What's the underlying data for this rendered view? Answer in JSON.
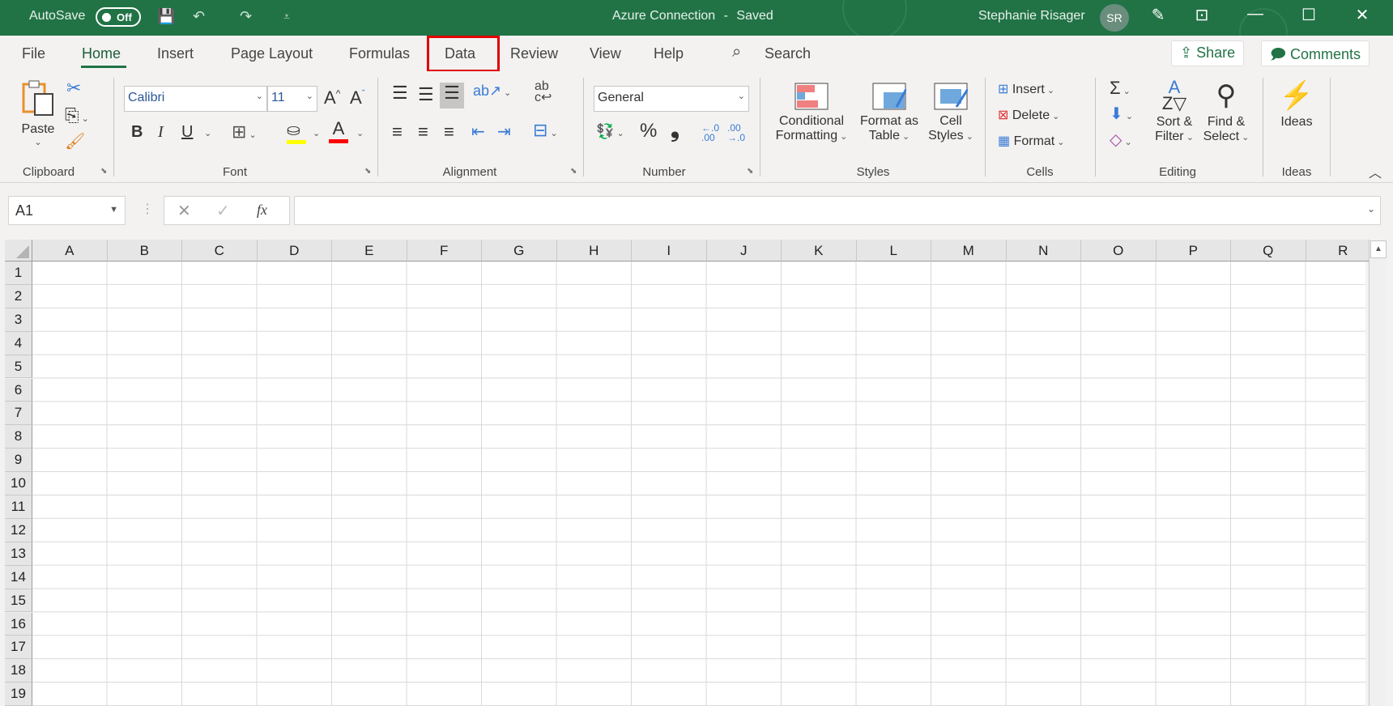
{
  "titlebar": {
    "autosave_label": "AutoSave",
    "autosave_state": "Off",
    "document_title": "Azure Connection",
    "title_separator": "-",
    "save_status": "Saved",
    "user_name": "Stephanie Risager",
    "user_initials": "SR",
    "icons": {
      "save": "💾",
      "undo": "↶",
      "redo": "↷",
      "customize": "⩡",
      "coauth": "✎",
      "ribbon_display": "⊡",
      "minimize": "—",
      "maximize": "☐",
      "close": "✕"
    }
  },
  "tabs": {
    "items": [
      {
        "label": "File"
      },
      {
        "label": "Home",
        "active": true
      },
      {
        "label": "Insert"
      },
      {
        "label": "Page Layout"
      },
      {
        "label": "Formulas"
      },
      {
        "label": "Data",
        "highlighted": true
      },
      {
        "label": "Review"
      },
      {
        "label": "View"
      },
      {
        "label": "Help"
      }
    ],
    "search_label": "Search",
    "share_label": "Share",
    "comments_label": "Comments"
  },
  "ribbon": {
    "clipboard": {
      "label": "Clipboard",
      "paste": "Paste"
    },
    "font": {
      "label": "Font",
      "font_name": "Calibri",
      "font_size": "11",
      "bold": "B",
      "italic": "I",
      "underline": "U",
      "grow": "A",
      "shrink": "A",
      "font_color_glyph": "A",
      "fill_color": "#ffff00",
      "font_color": "#ff0000"
    },
    "alignment": {
      "label": "Alignment"
    },
    "number": {
      "label": "Number",
      "format": "General",
      "percent": "%",
      "comma": "❟",
      "inc_decimal": ".00",
      "dec_decimal": ".0"
    },
    "styles": {
      "label": "Styles",
      "conditional_formatting": [
        "Conditional",
        "Formatting"
      ],
      "format_as_table": [
        "Format as",
        "Table"
      ],
      "cell_styles": [
        "Cell",
        "Styles"
      ]
    },
    "cells": {
      "label": "Cells",
      "insert": "Insert",
      "delete": "Delete",
      "format": "Format"
    },
    "editing": {
      "label": "Editing",
      "sort_filter": [
        "Sort &",
        "Filter"
      ],
      "find_select": [
        "Find &",
        "Select"
      ]
    },
    "ideas": {
      "label": "Ideas",
      "button": "Ideas"
    }
  },
  "formula_bar": {
    "name_box": "A1",
    "cancel": "✕",
    "enter": "✓",
    "fx": "fx",
    "content": ""
  },
  "sheet": {
    "columns": [
      "A",
      "B",
      "C",
      "D",
      "E",
      "F",
      "G",
      "H",
      "I",
      "J",
      "K",
      "L",
      "M",
      "N",
      "O",
      "P",
      "Q",
      "R"
    ],
    "rows": [
      "1",
      "2",
      "3",
      "4",
      "5",
      "6",
      "7",
      "8",
      "9",
      "10",
      "11",
      "12",
      "13",
      "14",
      "15",
      "16",
      "17",
      "18",
      "19"
    ]
  },
  "colors": {
    "brand": "#217346",
    "highlight_box": "#e00000"
  }
}
